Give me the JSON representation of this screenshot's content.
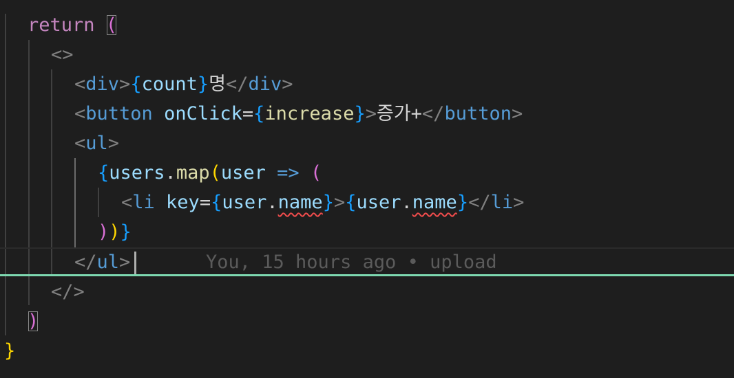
{
  "editor": {
    "lines": [
      {
        "kw": "return",
        "paren": "("
      },
      {
        "open_fragment": "<>"
      },
      {
        "lt": "<",
        "tag": "div",
        "gt": ">",
        "lb": "{",
        "var": "count",
        "rb": "}",
        "text": "명",
        "close_lt": "</",
        "close_tag": "div",
        "close_gt": ">"
      },
      {
        "lt": "<",
        "tag": "button",
        "attr": "onClick",
        "eq": "=",
        "lb": "{",
        "var": "increase",
        "rb": "}",
        "gt": ">",
        "text": "증가+",
        "close_lt": "</",
        "close_tag": "button",
        "close_gt": ">"
      },
      {
        "lt": "<",
        "tag": "ul",
        "gt": ">"
      },
      {
        "lb": "{",
        "obj": "users",
        "dot": ".",
        "fn": "map",
        "lp": "(",
        "param": "user",
        "arrow": "=>",
        "lp2": "("
      },
      {
        "lt": "<",
        "tag": "li",
        "attr": "key",
        "eq": "=",
        "lb": "{",
        "obj": "user",
        "dot": ".",
        "prop": "name",
        "rb": "}",
        "gt": ">",
        "lb2": "{",
        "obj2": "user",
        "dot2": ".",
        "prop2": "name",
        "rb2": "}",
        "close_lt": "</",
        "close_tag": "li",
        "close_gt": ">"
      },
      {
        "rp1": ")",
        "rp2": ")",
        "rb": "}"
      },
      {
        "close_lt": "</",
        "close_tag": "ul",
        "close_gt": ">"
      },
      {
        "close_fragment": "</>"
      },
      {
        "paren": ")"
      },
      {
        "brace": "}"
      }
    ],
    "blame": "You, 15 hours ago • upload"
  },
  "colors": {
    "background": "#1e1e1e",
    "keyword": "#c586c0",
    "tag": "#569cd6",
    "attribute": "#9cdcfe",
    "function": "#dcdcaa",
    "bracket_gold": "#ffd700",
    "bracket_pink": "#da70d6",
    "bracket_blue": "#179fff",
    "diff_added": "#7ed9b1",
    "error_squiggle": "#f14c4c"
  }
}
